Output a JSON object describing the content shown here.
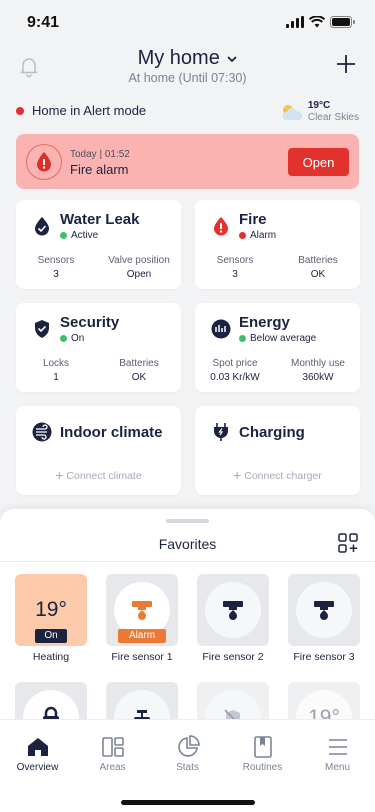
{
  "status_bar": {
    "time": "9:41"
  },
  "header": {
    "title": "My home",
    "subtitle": "At home (Until 07:30)"
  },
  "alert_mode": {
    "text": "Home in Alert mode",
    "color": "#e2322d"
  },
  "weather": {
    "temp": "19°C",
    "condition": "Clear Skies",
    "icon": "partly-cloudy-icon"
  },
  "fire_alert": {
    "date": "Today | 01:52",
    "title": "Fire alarm",
    "button": "Open"
  },
  "cards": {
    "water_leak": {
      "title": "Water Leak",
      "status": "Active",
      "status_color": "#3fbf6c",
      "stats": [
        {
          "label": "Sensors",
          "value": "3"
        },
        {
          "label": "Valve position",
          "value": "Open"
        }
      ]
    },
    "fire": {
      "title": "Fire",
      "status": "Alarm",
      "status_color": "#e2322d",
      "stats": [
        {
          "label": "Sensors",
          "value": "3"
        },
        {
          "label": "Batteries",
          "value": "OK"
        }
      ]
    },
    "security": {
      "title": "Security",
      "status": "On",
      "status_color": "#3fbf6c",
      "stats": [
        {
          "label": "Locks",
          "value": "1"
        },
        {
          "label": "Batteries",
          "value": "OK"
        }
      ]
    },
    "energy": {
      "title": "Energy",
      "status": "Below average",
      "status_color": "#3fbf6c",
      "stats": [
        {
          "label": "Spot price",
          "value": "0.03 Kr/kW"
        },
        {
          "label": "Monthly use",
          "value": "360kW"
        }
      ]
    },
    "indoor_climate": {
      "title": "Indoor climate",
      "connect": "Connect climate"
    },
    "charging": {
      "title": "Charging",
      "connect": "Connect charger"
    }
  },
  "favorites": {
    "title": "Favorites",
    "tiles": [
      {
        "label": "Heating",
        "temp": "19°",
        "badge": "On"
      },
      {
        "label": "Fire sensor 1",
        "badge": "Alarm"
      },
      {
        "label": "Fire sensor 2"
      },
      {
        "label": "Fire sensor 3"
      }
    ],
    "partial_row_temp": "19°"
  },
  "tabs": [
    {
      "label": "Overview",
      "icon": "home-icon",
      "active": true
    },
    {
      "label": "Areas",
      "icon": "areas-icon"
    },
    {
      "label": "Stats",
      "icon": "pie-chart-icon"
    },
    {
      "label": "Routines",
      "icon": "book-icon"
    },
    {
      "label": "Menu",
      "icon": "menu-icon"
    }
  ]
}
